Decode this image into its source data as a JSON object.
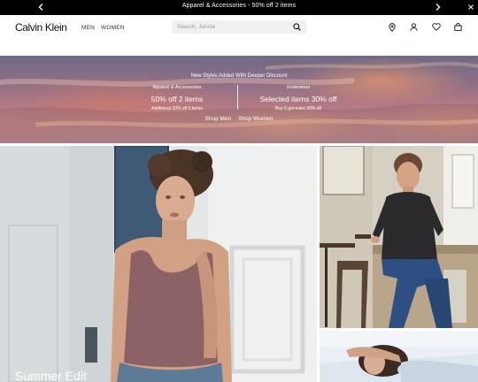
{
  "promo": {
    "text": "Apparel & Accessories - 50% off 2 items"
  },
  "header": {
    "logo": "Calvin Klein",
    "nav": [
      {
        "label": "MEN"
      },
      {
        "label": "WOMEN"
      }
    ],
    "search": {
      "placeholder": "Search, Jennie"
    },
    "icons": [
      "store-locator-icon",
      "account-icon",
      "wishlist-icon",
      "bag-icon"
    ]
  },
  "hero": {
    "heading": "New Styles Added With Deeper Discount",
    "left": {
      "category": "Apparel & Accessories",
      "headline": "50% off 2 items",
      "sub": "Additional 20% off 5 items"
    },
    "right": {
      "category": "Underwear",
      "headline": "Selected items 30% off",
      "sub": "Buy 6 get extra 30% off"
    },
    "links": [
      {
        "label": "Shop Men"
      },
      {
        "label": "Shop Women"
      }
    ]
  },
  "tiles": {
    "main_caption": "Summer Edit"
  },
  "colors": {
    "promo_bg": "#000000",
    "search_bg": "#f1f1f1",
    "hero_sky": "#b07884"
  }
}
